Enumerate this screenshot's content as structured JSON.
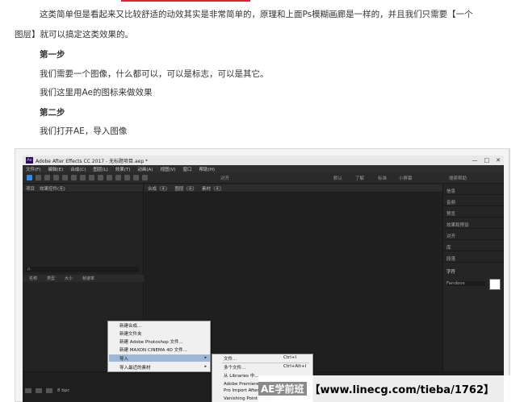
{
  "article": {
    "para1_line1": "这类简单但是看起来又比较舒适的动效其实是非常简单的，原理和上面Ps模糊画廊是一样的，并且我们只需要【一个",
    "para1_line2": "图层】就可以搞定这类效果的。",
    "step1": "第一步",
    "step1_text1": "我们需要一个图像，什么都可以，可以是标志，可以是其它。",
    "step1_text2": "我们这里用Ae的图标来做效果",
    "step2": "第二步",
    "step2_text": "我们打开AE，导入图像"
  },
  "ae": {
    "title": "Adobe After Effects CC 2017 - 无标题项目.aep *",
    "logo": "Ae",
    "window_buttons": [
      "—",
      "□",
      "✕"
    ],
    "menu": [
      "文件(F)",
      "编辑(E)",
      "合成(C)",
      "图层(L)",
      "效果(T)",
      "动画(A)",
      "视图(V)",
      "窗口",
      "帮助(H)"
    ],
    "toolbar_snap": "对齐",
    "toolbar_default": "默认",
    "toolbar_learn": "了解",
    "toolbar_standard": "标准",
    "toolbar_small": "小屏幕",
    "toolbar_search": "搜索帮助",
    "project_tab": "项目",
    "effects_tab": "效果控件(无)",
    "comp_tab": "合成（无）",
    "layer_tab": "图层（无）",
    "footage_tab": "素材（无）",
    "search_placeholder": "ρ.",
    "col_name": "名称",
    "col_type": "类型",
    "col_size": "大小",
    "col_rate": "帧速率",
    "bpc": "8 bpc",
    "right_panel": [
      "信息",
      "音频",
      "预览",
      "效果和预设",
      "对齐",
      "库",
      "段落",
      "字符"
    ],
    "char_label": "字符",
    "font_name": "Fandoos",
    "context_menu": {
      "items": [
        "新建合成...",
        "新建文件夹",
        "新建 Adobe Photoshop 文件...",
        "新建 MAXON CINEMA 4D 文件...",
        "导入",
        "导入最近的素材"
      ],
      "highlighted_index": 4
    },
    "submenu": {
      "items": [
        "文件...",
        "多个文件...",
        "从 Libraries 中...",
        "Adobe Premiere Pro 项目...",
        "Pro Import After Effects...",
        "Vanishing Point (.vpe)..."
      ],
      "shortcuts": [
        "Ctrl+I",
        "Ctrl+Alt+I",
        "",
        "",
        "",
        ""
      ]
    }
  },
  "watermark": {
    "tag": "AE学前班",
    "text": "【www.linecg.com/tieba/1762】"
  },
  "colors": {
    "ae_bg": "#232323",
    "accent_blue": "#2d8ceb",
    "menu_highlight": "#9fb8d8"
  }
}
